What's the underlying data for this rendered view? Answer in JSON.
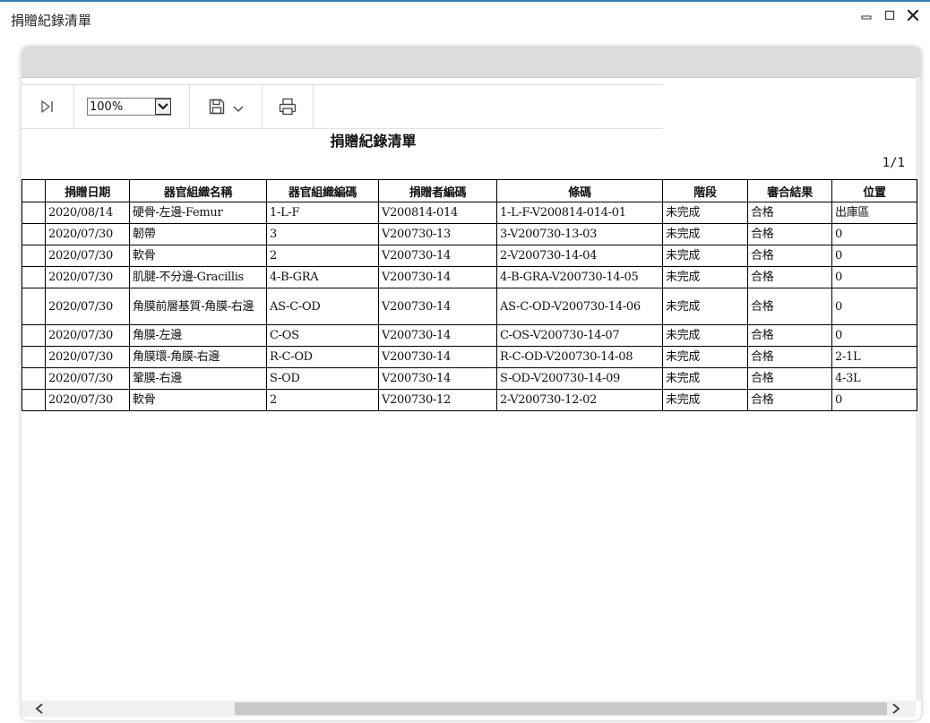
{
  "window": {
    "title": "捐贈紀錄清單"
  },
  "toolbar": {
    "zoom_value": "100%"
  },
  "report": {
    "title": "捐贈紀錄清單",
    "page_indicator": "1/1",
    "columns": [
      "捐贈日期",
      "器官組織名稱",
      "器官組織編碼",
      "捐贈者編碼",
      "條碼",
      "階段",
      "審合結果",
      "位置"
    ],
    "rows": [
      [
        "2020/08/14",
        "硬骨-左邊-Femur",
        "1-L-F",
        "V200814-014",
        "1-L-F-V200814-014-01",
        "未完成",
        "合格",
        "出庫區"
      ],
      [
        "2020/07/30",
        "韌帶",
        "3",
        "V200730-13",
        "3-V200730-13-03",
        "未完成",
        "合格",
        "0"
      ],
      [
        "2020/07/30",
        "軟骨",
        "2",
        "V200730-14",
        "2-V200730-14-04",
        "未完成",
        "合格",
        "0"
      ],
      [
        "2020/07/30",
        "肌腱-不分邊-Gracillis",
        "4-B-GRA",
        "V200730-14",
        "4-B-GRA-V200730-14-05",
        "未完成",
        "合格",
        "0"
      ],
      [
        "2020/07/30",
        "角膜前層基質-角膜-右邊",
        "AS-C-OD",
        "V200730-14",
        "AS-C-OD-V200730-14-06",
        "未完成",
        "合格",
        "0"
      ],
      [
        "2020/07/30",
        "角膜-左邊",
        "C-OS",
        "V200730-14",
        "C-OS-V200730-14-07",
        "未完成",
        "合格",
        "0"
      ],
      [
        "2020/07/30",
        "角膜環-角膜-右邊",
        "R-C-OD",
        "V200730-14",
        "R-C-OD-V200730-14-08",
        "未完成",
        "合格",
        "2-1L"
      ],
      [
        "2020/07/30",
        "鞏膜-右邊",
        "S-OD",
        "V200730-14",
        "S-OD-V200730-14-09",
        "未完成",
        "合格",
        "4-3L"
      ],
      [
        "2020/07/30",
        "軟骨",
        "2",
        "V200730-12",
        "2-V200730-12-02",
        "未完成",
        "合格",
        "0"
      ]
    ]
  }
}
